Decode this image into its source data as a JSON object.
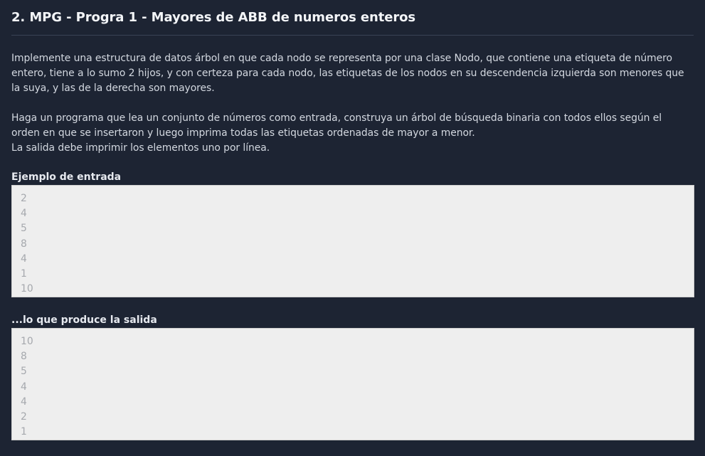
{
  "problem": {
    "title": "2. MPG - Progra 1 - Mayores de ABB de numeros enteros",
    "paragraph1": "Implemente una estructura de datos árbol en que cada nodo se representa por una clase Nodo, que contiene una etiqueta de número\nentero, tiene a lo sumo 2 hijos, y con certeza para cada nodo, las etiquetas de los nodos en su descendencia izquierda son menores que\nla suya, y las de la derecha son mayores.",
    "paragraph2": "Haga un programa que lea un conjunto de números como entrada, construya un árbol de búsqueda binaria con todos ellos según el\norden en que se insertaron y luego imprima todas las etiquetas ordenadas de mayor a menor.\nLa salida debe imprimir los elementos uno por línea."
  },
  "example_input": {
    "label": "Ejemplo de entrada",
    "lines": [
      "2",
      "4",
      "5",
      "8",
      "4",
      "1",
      "10"
    ]
  },
  "example_output": {
    "label": "...lo que produce la salida",
    "lines": [
      "10",
      "8",
      "5",
      "4",
      "4",
      "2",
      "1"
    ]
  }
}
